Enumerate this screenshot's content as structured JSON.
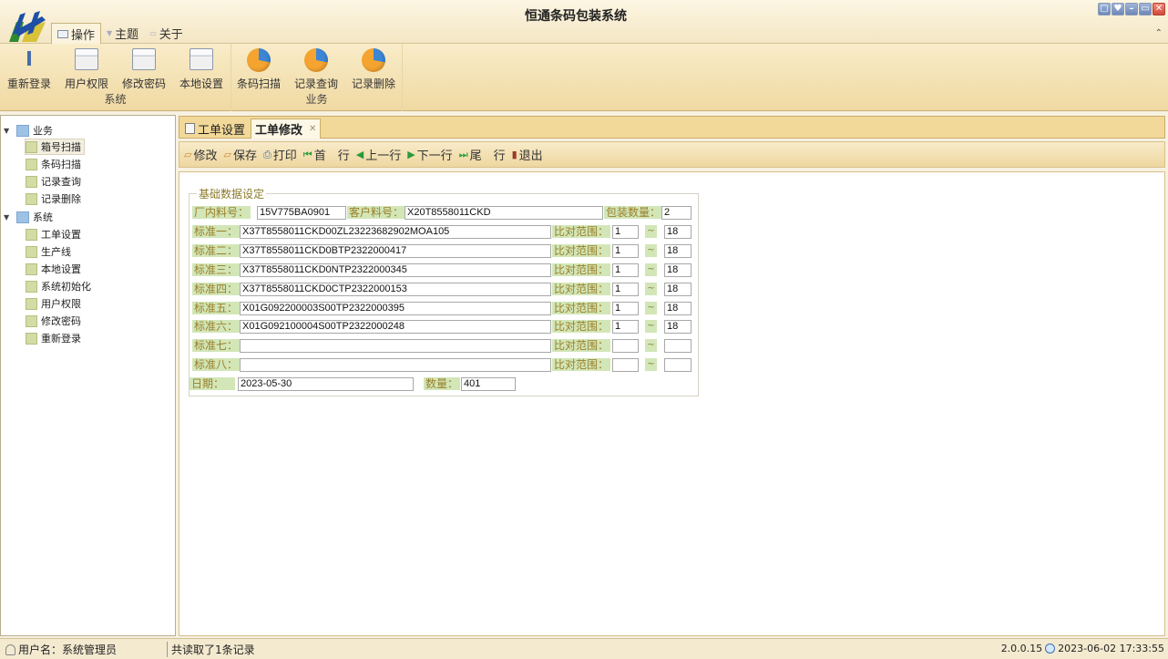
{
  "window": {
    "title": "恒通条码包装系统"
  },
  "menu_tabs": [
    {
      "label": "操作"
    },
    {
      "label": "主题"
    },
    {
      "label": "关于"
    }
  ],
  "ribbon": {
    "groups": [
      {
        "label": "系统",
        "buttons": [
          "重新登录",
          "用户权限",
          "修改密码",
          "本地设置"
        ]
      },
      {
        "label": "业务",
        "buttons": [
          "条码扫描",
          "记录查询",
          "记录删除"
        ]
      }
    ]
  },
  "sidebar": {
    "business": {
      "label": "业务",
      "items": [
        "箱号扫描",
        "条码扫描",
        "记录查询",
        "记录删除"
      ]
    },
    "system": {
      "label": "系统",
      "items": [
        "工单设置",
        "生产线",
        "本地设置",
        "系统初始化",
        "用户权限",
        "修改密码",
        "重新登录"
      ]
    }
  },
  "doc_tabs": [
    {
      "label": "工单设置"
    },
    {
      "label": "工单修改"
    }
  ],
  "toolbar": {
    "edit": "修改",
    "save": "保存",
    "print": "打印",
    "first": "首　行",
    "prev": "上一行",
    "next": "下一行",
    "last": "尾　行",
    "exit": "退出"
  },
  "form": {
    "legend": "基础数据设定",
    "factory_part_label": "厂内料号：",
    "factory_part_value": "15V775BA0901",
    "customer_part_label": "客户料号：",
    "customer_part_value": "X20T8558011CKD",
    "pack_qty_label": "包装数量：",
    "pack_qty_value": "2",
    "range_label": "比对范围：",
    "tilde": "~",
    "standards": [
      {
        "label": "标准一：",
        "value": "X37T8558011CKD00ZL23223682902MOA105",
        "from": "1",
        "to": "18"
      },
      {
        "label": "标准二：",
        "value": "X37T8558011CKD0BTP2322000417",
        "from": "1",
        "to": "18"
      },
      {
        "label": "标准三：",
        "value": "X37T8558011CKD0NTP2322000345",
        "from": "1",
        "to": "18"
      },
      {
        "label": "标准四：",
        "value": "X37T8558011CKD0CTP2322000153",
        "from": "1",
        "to": "18"
      },
      {
        "label": "标准五：",
        "value": "X01G092200003S00TP2322000395",
        "from": "1",
        "to": "18"
      },
      {
        "label": "标准六：",
        "value": "X01G092100004S00TP2322000248",
        "from": "1",
        "to": "18"
      },
      {
        "label": "标准七：",
        "value": "",
        "from": "",
        "to": ""
      },
      {
        "label": "标准八：",
        "value": "",
        "from": "",
        "to": ""
      }
    ],
    "date_label": "日期：",
    "date_value": "2023-05-30",
    "qty_label": "数量：",
    "qty_value": "401"
  },
  "status": {
    "user": "用户名：系统管理员",
    "message": "共读取了1条记录",
    "version": "2.0.0.15",
    "datetime": "2023-06-02 17:33:55"
  }
}
